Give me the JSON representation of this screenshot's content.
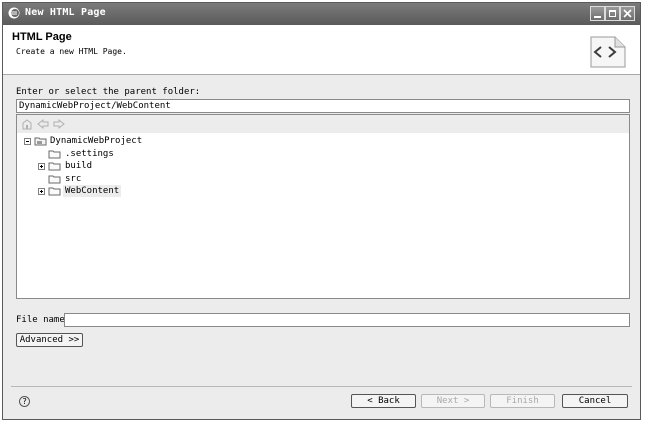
{
  "window": {
    "title": "New HTML Page",
    "icon": "eclipse-icon"
  },
  "banner": {
    "title": "HTML Page",
    "description": "Create a new HTML Page.",
    "icon": "html-tag-icon"
  },
  "parent_folder": {
    "label": "Enter or select the parent folder:",
    "value": "DynamicWebProject/WebContent"
  },
  "tree": {
    "toolbar_icons": [
      "home-icon",
      "back-arrow-icon",
      "forward-arrow-icon"
    ],
    "root": "DynamicWebProject",
    "children": [
      ".settings",
      "build",
      "src",
      "WebContent"
    ],
    "selected": "WebContent"
  },
  "file_name": {
    "label": "File name:",
    "value": ""
  },
  "advanced_button": "Advanced >>",
  "footer": {
    "help_glyph": "?",
    "back_label": "< Back",
    "next_label": "Next >",
    "finish_label": "Finish",
    "cancel_label": "Cancel"
  }
}
